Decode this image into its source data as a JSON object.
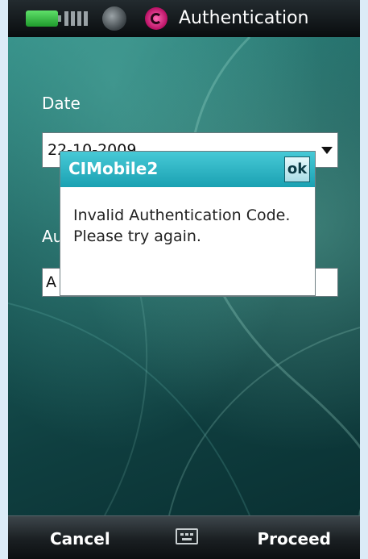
{
  "status_bar": {
    "icons": [
      "battery-icon",
      "signal-icon",
      "globe-icon",
      "sync-icon"
    ],
    "title": "Authentication"
  },
  "form": {
    "date_label": "Date",
    "date_value": "22-10-2009",
    "auth_label": "Au",
    "auth_value": "A"
  },
  "dialog": {
    "title": "CIMobile2",
    "ok_label": "ok",
    "message": "Invalid Authentication Code. Please try again."
  },
  "softkeys": {
    "left": "Cancel",
    "center_icon": "keyboard-icon",
    "right": "Proceed"
  },
  "colors": {
    "dialog_header": "#1aa1b2",
    "background": "#1b5c5a",
    "battery": "#1f9b2c"
  }
}
